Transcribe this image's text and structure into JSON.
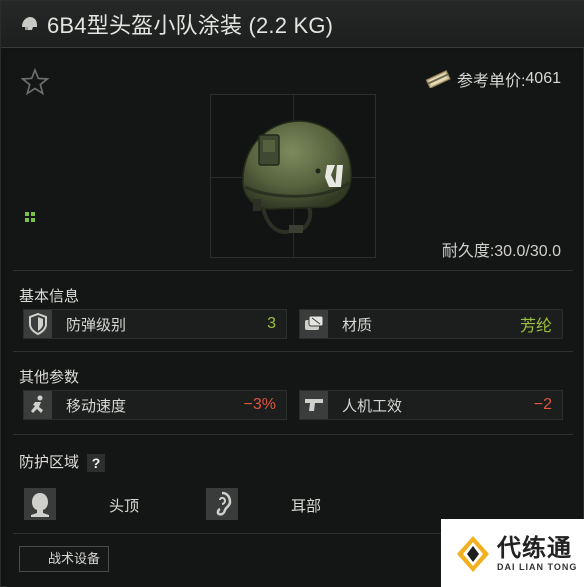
{
  "title": "6B4型头盔小队涂装 (2.2 KG)",
  "price": {
    "label": "参考单价:",
    "value": "4061"
  },
  "durability": {
    "label": "耐久度:",
    "value": "30.0/30.0"
  },
  "basic": {
    "title": "基本信息",
    "items": [
      {
        "label": "防弹级别",
        "value": "3",
        "icon": "shield-icon"
      },
      {
        "label": "材质",
        "value": "芳纶",
        "icon": "fabric-roll-icon"
      }
    ]
  },
  "other": {
    "title": "其他参数",
    "items": [
      {
        "label": "移动速度",
        "value": "−3%",
        "icon": "running-man-icon"
      },
      {
        "label": "人机工效",
        "value": "−2",
        "icon": "pistol-icon"
      }
    ]
  },
  "protection": {
    "title": "防护区域",
    "help": "?",
    "zones": [
      {
        "label": "头顶",
        "icon": "head-top-icon"
      },
      {
        "label": "耳部",
        "icon": "ear-icon"
      }
    ]
  },
  "tactical": {
    "label": "战术设备"
  },
  "watermark": {
    "cn": "代练通",
    "en": "DAI LIAN TONG"
  },
  "colors": {
    "positive": "#9cc23d",
    "negative": "#e0543c",
    "accent_green": "#7cc242"
  }
}
